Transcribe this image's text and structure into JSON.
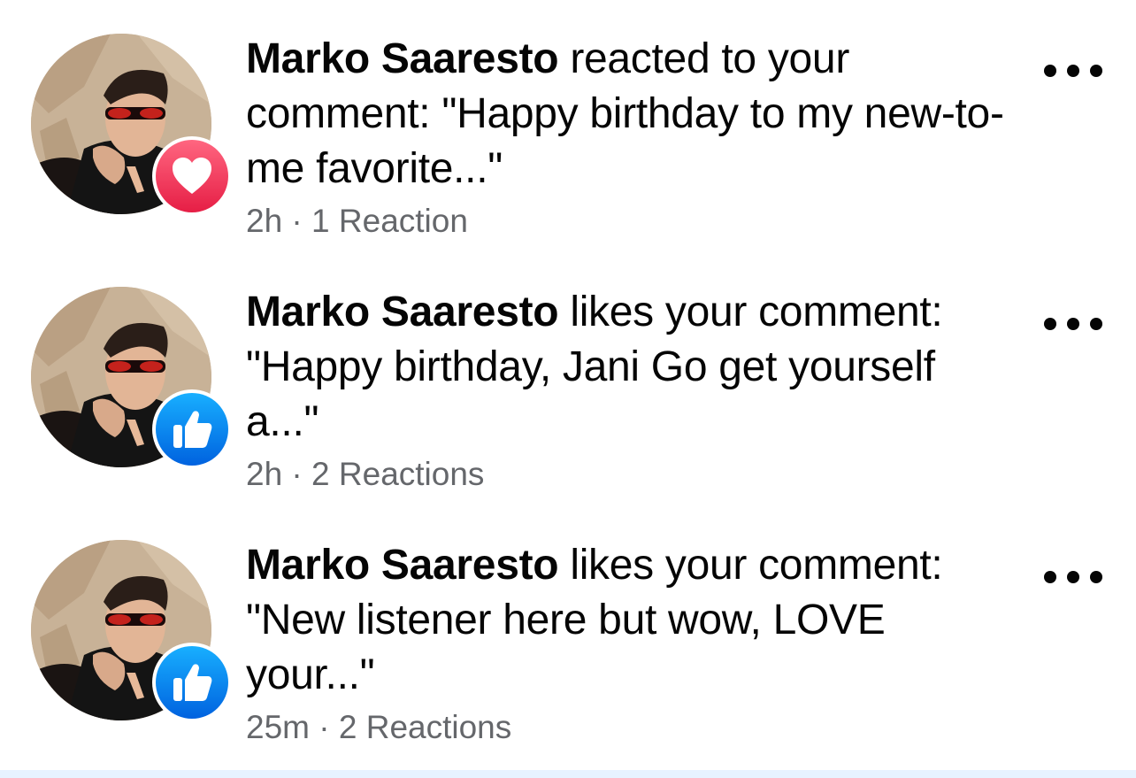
{
  "notifications": [
    {
      "actor": "Marko Saaresto",
      "action": " reacted to your comment: \"Happy birthday to my new-to-me favorite...\"",
      "time": "2h",
      "separator": " · ",
      "reactions": "1 Reaction",
      "badge_icon": "heart-icon",
      "badge_color": "#f33e58"
    },
    {
      "actor": "Marko Saaresto",
      "action": " likes your comment: \"Happy birthday, Jani Go get yourself a...\"",
      "time": "2h",
      "separator": " · ",
      "reactions": "2 Reactions",
      "badge_icon": "thumbs-up-icon",
      "badge_color": "#1877f2"
    },
    {
      "actor": "Marko Saaresto",
      "action": " likes your comment: \"New listener here but wow, LOVE your...\"",
      "time": "25m",
      "separator": " · ",
      "reactions": "2 Reactions",
      "badge_icon": "thumbs-up-icon",
      "badge_color": "#1877f2"
    }
  ]
}
